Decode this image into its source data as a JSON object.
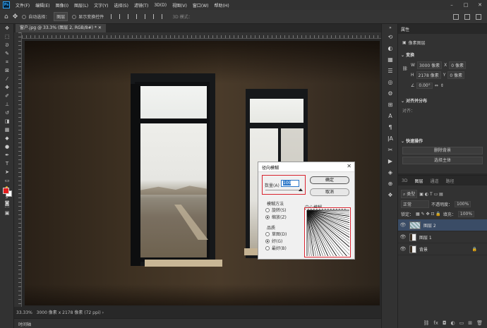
{
  "menubar": {
    "items": [
      "文件(F)",
      "编辑(E)",
      "图像(I)",
      "图层(L)",
      "文字(Y)",
      "选择(S)",
      "滤镜(T)",
      "3D(D)",
      "视图(V)",
      "窗口(W)",
      "帮助(H)"
    ],
    "logo": "Ps"
  },
  "options": {
    "auto_select": "自动选择：",
    "auto_select_target": "图层",
    "show_transform": "显示变换控件",
    "mode3d": "3D 模式："
  },
  "document": {
    "tab_title": "窗户.jpg @ 33.3% (图层 2, RGB/8#) *",
    "zoom": "33.33%",
    "size_info": "3000 像素 x 2178 像素 (72 ppi)"
  },
  "dialog": {
    "title": "径向模糊",
    "amount_label": "数量(A)",
    "amount_value": "100",
    "ok": "确定",
    "cancel": "取消",
    "method_label": "模糊方法",
    "method_options": [
      "旋转(S)",
      "缩放(Z)"
    ],
    "method_selected": 1,
    "quality_label": "品质",
    "quality_options": [
      "草图(D)",
      "好(G)",
      "最好(B)"
    ],
    "quality_selected": 1,
    "center_label": "中心模糊"
  },
  "properties": {
    "tab": "属性",
    "type": "像素图层",
    "transform_label": "变换",
    "w_label": "W",
    "w_value": "3000 像素",
    "h_label": "H",
    "h_value": "2178 像素",
    "x_label": "X",
    "x_value": "0 像素",
    "y_label": "Y",
    "y_value": "0 像素",
    "angle": "0.00°",
    "align_label": "对齐并分布",
    "align_sub": "对齐：",
    "quick_actions": "快速操作",
    "remove_bg": "删除背景",
    "select_subject": "选择主体"
  },
  "layers": {
    "tabs": [
      "3D",
      "图层",
      "通道",
      "路径"
    ],
    "active_tab": 1,
    "kind_label": "类型",
    "blend": "正常",
    "opacity_label": "不透明度：",
    "opacity": "100%",
    "lock_label": "锁定：",
    "fill_label": "填充：",
    "fill": "100%",
    "items": [
      {
        "name": "图层 2",
        "selected": true
      },
      {
        "name": "图层 1",
        "selected": false
      },
      {
        "name": "背景",
        "selected": false,
        "locked": true
      }
    ]
  },
  "timeline": "时间轴",
  "colors": {
    "foreground": "#e11d1d",
    "background": "#ffffff",
    "highlight": "#d9232e",
    "selection": "#3a4c66"
  }
}
